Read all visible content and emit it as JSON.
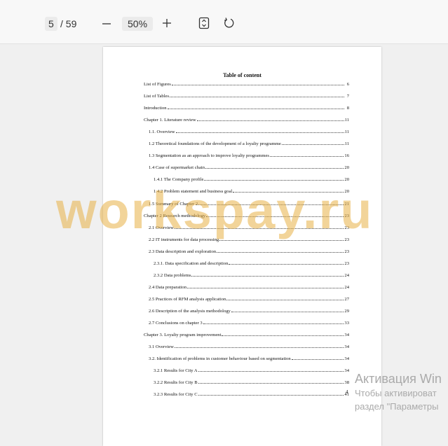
{
  "toolbar": {
    "current_page": "5",
    "total_pages": "/ 59",
    "zoom_out_icon": "minus-icon",
    "zoom_level": "50%",
    "zoom_in_icon": "plus-icon",
    "fit_page_icon": "fit-page-icon",
    "rotate_icon": "rotate-icon"
  },
  "document": {
    "title": "Table of content",
    "entries": [
      {
        "text": "List of Figures",
        "page": "6"
      },
      {
        "text": "List of Tables",
        "page": "7"
      },
      {
        "text": "Introduction",
        "page": "8"
      },
      {
        "text": "Chapter 1. Literature review",
        "page": "11"
      },
      {
        "text": "1.1. Overview",
        "page": "11"
      },
      {
        "text": "1.2 Theoretical foundations of the development of a loyalty programme",
        "page": "11"
      },
      {
        "text": "1.3 Segmentation as an approach to improve loyalty programmes",
        "page": "16"
      },
      {
        "text": "1.4 Case of supermarket chain",
        "page": "20"
      },
      {
        "text": "1.4.1 The Company profile",
        "page": "20"
      },
      {
        "text": "1.4.2 Problem statement and business goal",
        "page": "20"
      },
      {
        "text": "1.5 Summary of Chapter 2",
        "page": "21"
      },
      {
        "text": "Chapter 2 Research methodology",
        "page": "23"
      },
      {
        "text": "2.1 Overview",
        "page": "23"
      },
      {
        "text": "2.2 IT instruments for data processing",
        "page": "23"
      },
      {
        "text": "2.3 Data description and exploration",
        "page": "23"
      },
      {
        "text": "2.3.1. Data specification and description",
        "page": "23"
      },
      {
        "text": "2.3.2 Data problems",
        "page": "24"
      },
      {
        "text": "2.4 Data preparation",
        "page": "24"
      },
      {
        "text": "2.5 Practices of RFM analysis application",
        "page": "27"
      },
      {
        "text": "2.6 Description of the analysis methodology",
        "page": "29"
      },
      {
        "text": "2.7 Conclusions on chapter 3",
        "page": "33"
      },
      {
        "text": "Chapter 3. Loyalty program improvement",
        "page": "34"
      },
      {
        "text": "3.1 Overview",
        "page": "34"
      },
      {
        "text": "3.2. Identification of problems in customer behaviour based on segmentation",
        "page": "34"
      },
      {
        "text": "3.2.1 Results for City A",
        "page": "34"
      },
      {
        "text": "3.2.2 Results for City B",
        "page": "38"
      },
      {
        "text": "3.2.3 Results for City C",
        "page": "41"
      }
    ],
    "page_number": "4"
  },
  "watermark": "workspay.ru",
  "activation": {
    "title": "Активация Win",
    "line1": "Чтобы активироват",
    "line2": "раздел \"Параметры"
  }
}
